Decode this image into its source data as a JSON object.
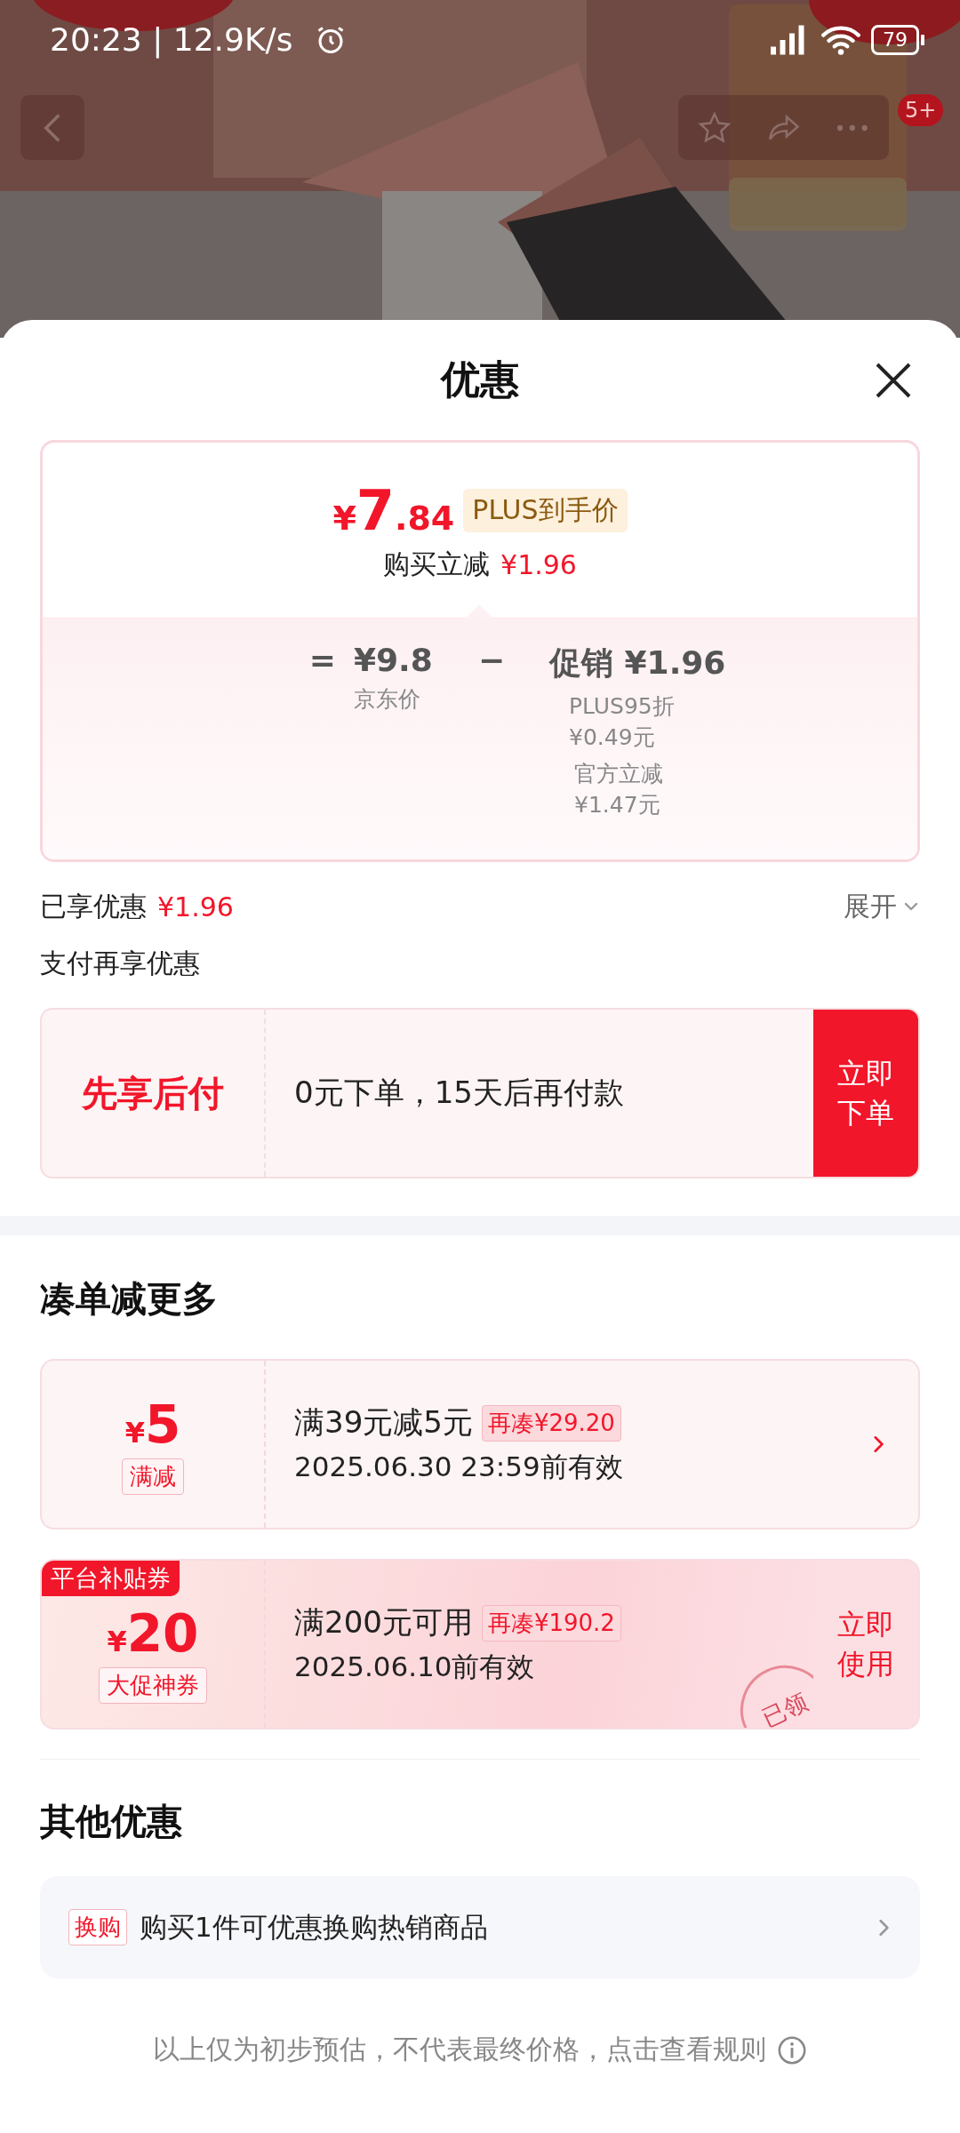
{
  "status_bar": {
    "time": "20:23 | 12.9K/s",
    "battery": "79"
  },
  "header": {
    "badge": "5+"
  },
  "sheet": {
    "title": "优惠"
  },
  "price_card": {
    "symbol": "¥",
    "price_int": "7",
    "price_dec": ".84",
    "price_tag": "PLUS到手价",
    "instant_label": "购买立减",
    "instant_amount": "¥1.96",
    "equals": "=",
    "jd_price": "¥9.8",
    "minus": "−",
    "promo_label": "促销",
    "promo_amount": "¥1.96",
    "jd_price_label": "京东价",
    "promo_details": [
      {
        "name": "PLUS95折",
        "amount": "¥0.49元"
      },
      {
        "name": "官方立减",
        "amount": "¥1.47元"
      }
    ]
  },
  "enjoyed": {
    "label": "已享优惠",
    "amount": "¥1.96",
    "expand": "展开"
  },
  "pay_section": {
    "title": "支付再享优惠",
    "name": "先享后付",
    "desc": "0元下单，15天后再付款",
    "button": "立即下单"
  },
  "coupons_section": {
    "title": "凑单减更多",
    "coupons": [
      {
        "kind": "discount",
        "symbol": "¥",
        "amount": "5",
        "type_tag": "满减",
        "condition": "满39元减5元",
        "gap": "再凑¥29.20",
        "validity": "2025.06.30 23:59前有效"
      },
      {
        "kind": "platform",
        "corner": "平台补贴券",
        "symbol": "¥",
        "amount": "20",
        "type_tag": "大促神券",
        "condition": "满200元可用",
        "gap": "再凑¥190.2",
        "validity": "2025.06.10前有效",
        "button": "立即使用",
        "stamp": "已领"
      }
    ]
  },
  "other_section": {
    "title": "其他优惠",
    "items": [
      {
        "tag": "换购",
        "text": "购买1件可优惠换购热销商品"
      }
    ]
  },
  "footer": {
    "text": "以上仅为初步预估，不代表最终价格，点击查看规则"
  }
}
